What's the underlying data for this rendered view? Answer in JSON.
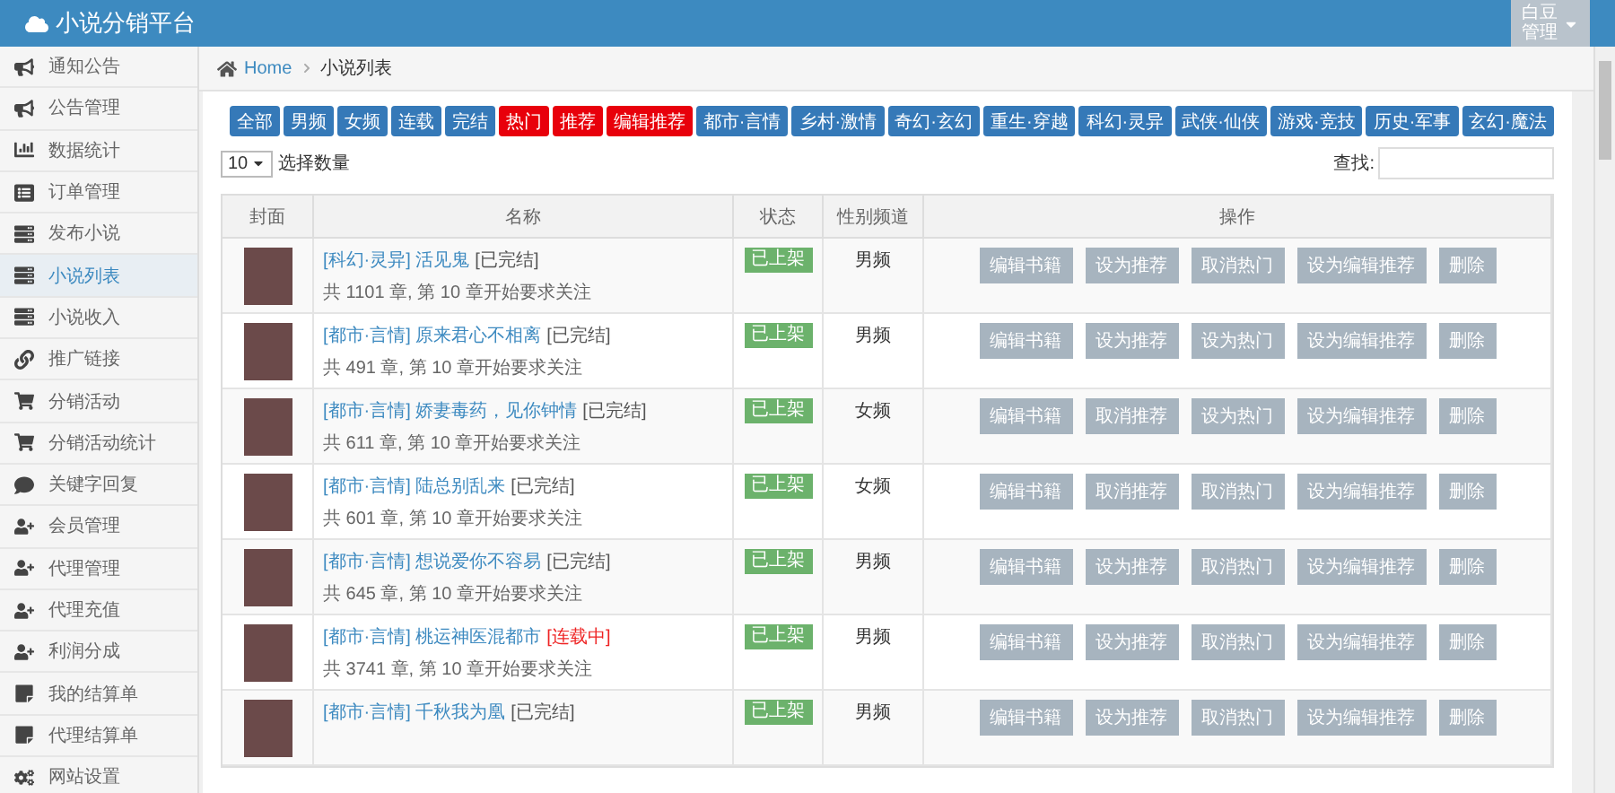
{
  "header": {
    "logo": "小说分销平台",
    "user_name": "白豆",
    "user_role": "管理"
  },
  "sidebar": {
    "items": [
      {
        "label": "通知公告",
        "kind": "bullhorn",
        "selected": false
      },
      {
        "label": "公告管理",
        "kind": "bullhorn",
        "selected": false
      },
      {
        "label": "数据统计",
        "kind": "chart",
        "selected": false
      },
      {
        "label": "订单管理",
        "kind": "card",
        "selected": false
      },
      {
        "label": "发布小说",
        "kind": "list",
        "selected": false
      },
      {
        "label": "小说列表",
        "kind": "list",
        "selected": true
      },
      {
        "label": "小说收入",
        "kind": "list",
        "selected": false
      },
      {
        "label": "推广链接",
        "kind": "link",
        "selected": false
      },
      {
        "label": "分销活动",
        "kind": "cart",
        "selected": false
      },
      {
        "label": "分销活动统计",
        "kind": "cart",
        "selected": false
      },
      {
        "label": "关键字回复",
        "kind": "comment",
        "selected": false
      },
      {
        "label": "会员管理",
        "kind": "user",
        "selected": false
      },
      {
        "label": "代理管理",
        "kind": "user",
        "selected": false
      },
      {
        "label": "代理充值",
        "kind": "user",
        "selected": false
      },
      {
        "label": "利润分成",
        "kind": "user",
        "selected": false
      },
      {
        "label": "我的结算单",
        "kind": "note",
        "selected": false
      },
      {
        "label": "代理结算单",
        "kind": "note",
        "selected": false
      },
      {
        "label": "网站设置",
        "kind": "cogs",
        "selected": false
      }
    ]
  },
  "breadcrumb": {
    "home": "Home",
    "current": "小说列表"
  },
  "filters": [
    {
      "label": "全部",
      "active": false
    },
    {
      "label": "男频",
      "active": false
    },
    {
      "label": "女频",
      "active": false
    },
    {
      "label": "连载",
      "active": false
    },
    {
      "label": "完结",
      "active": false
    },
    {
      "label": "热门",
      "active": true
    },
    {
      "label": "推荐",
      "active": true
    },
    {
      "label": "编辑推荐",
      "active": true
    },
    {
      "label": "都市·言情",
      "active": false
    },
    {
      "label": "乡村·激情",
      "active": false
    },
    {
      "label": "奇幻·玄幻",
      "active": false
    },
    {
      "label": "重生·穿越",
      "active": false
    },
    {
      "label": "科幻·灵异",
      "active": false
    },
    {
      "label": "武侠·仙侠",
      "active": false
    },
    {
      "label": "游戏·竞技",
      "active": false
    },
    {
      "label": "历史·军事",
      "active": false
    },
    {
      "label": "玄幻·魔法",
      "active": false
    }
  ],
  "page_size": {
    "value": "10",
    "label": "选择数量"
  },
  "search": {
    "label": "查找:"
  },
  "table": {
    "columns": [
      "封面",
      "名称",
      "状态",
      "性别频道",
      "操作"
    ],
    "rows": [
      {
        "title": "[科幻·灵异] 活见鬼",
        "status": "[已完结]",
        "ongoing": false,
        "chapters": "共 1101 章, 第 10 章开始要求关注",
        "shelf": "已上架",
        "channel": "男频",
        "actions": [
          "编辑书籍",
          "设为推荐",
          "取消热门",
          "设为编辑推荐",
          "删除"
        ]
      },
      {
        "title": "[都市·言情] 原来君心不相离",
        "status": "[已完结]",
        "ongoing": false,
        "chapters": "共 491 章, 第 10 章开始要求关注",
        "shelf": "已上架",
        "channel": "男频",
        "actions": [
          "编辑书籍",
          "设为推荐",
          "设为热门",
          "设为编辑推荐",
          "删除"
        ]
      },
      {
        "title": "[都市·言情] 娇妻毒药，见你钟情",
        "status": "[已完结]",
        "ongoing": false,
        "chapters": "共 611 章, 第 10 章开始要求关注",
        "shelf": "已上架",
        "channel": "女频",
        "actions": [
          "编辑书籍",
          "取消推荐",
          "设为热门",
          "设为编辑推荐",
          "删除"
        ]
      },
      {
        "title": "[都市·言情] 陆总别乱来",
        "status": "[已完结]",
        "ongoing": false,
        "chapters": "共 601 章, 第 10 章开始要求关注",
        "shelf": "已上架",
        "channel": "女频",
        "actions": [
          "编辑书籍",
          "取消推荐",
          "取消热门",
          "设为编辑推荐",
          "删除"
        ]
      },
      {
        "title": "[都市·言情] 想说爱你不容易",
        "status": "[已完结]",
        "ongoing": false,
        "chapters": "共 645 章, 第 10 章开始要求关注",
        "shelf": "已上架",
        "channel": "男频",
        "actions": [
          "编辑书籍",
          "设为推荐",
          "取消热门",
          "设为编辑推荐",
          "删除"
        ]
      },
      {
        "title": "[都市·言情] 桃运神医混都市",
        "status": "[连载中]",
        "ongoing": true,
        "chapters": "共 3741 章, 第 10 章开始要求关注",
        "shelf": "已上架",
        "channel": "男频",
        "actions": [
          "编辑书籍",
          "设为推荐",
          "取消热门",
          "设为编辑推荐",
          "删除"
        ]
      },
      {
        "title": "[都市·言情] 千秋我为凰",
        "status": "[已完结]",
        "ongoing": false,
        "shelf": "已上架",
        "channel": "男频",
        "actions": [
          "编辑书籍",
          "设为推荐",
          "取消热门",
          "设为编辑推荐",
          "删除"
        ]
      }
    ]
  }
}
